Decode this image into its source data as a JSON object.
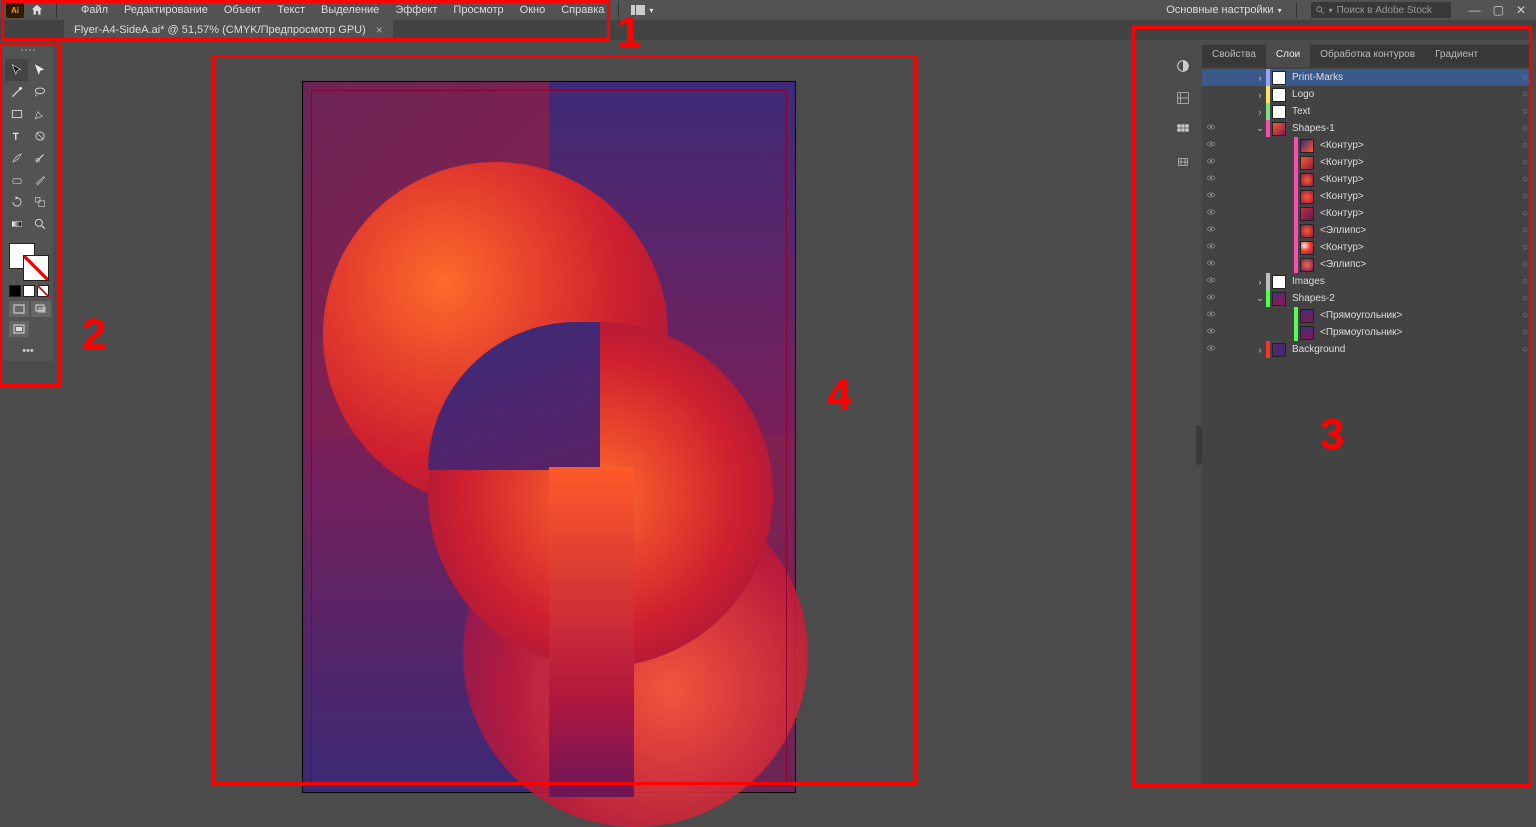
{
  "app": {
    "logo_text": "Ai"
  },
  "menu": {
    "items": [
      "Файл",
      "Редактирование",
      "Объект",
      "Текст",
      "Выделение",
      "Эффект",
      "Просмотр",
      "Окно",
      "Справка"
    ]
  },
  "workspace": {
    "label": "Основные настройки",
    "search_placeholder": "Поиск в Adobe Stock"
  },
  "document": {
    "tab_label": "Flyer-A4-SideA.ai* @ 51,57% (CMYK/Предпросмотр GPU)"
  },
  "panel": {
    "tabs": [
      "Свойства",
      "Слои",
      "Обработка контуров",
      "Градиент"
    ],
    "active_tab": 1,
    "layers": [
      {
        "name": "Print-Marks",
        "depth": 0,
        "color": "#9aa4ff",
        "thumb": "#ffffff",
        "vis": false,
        "exp": ">",
        "selected": true
      },
      {
        "name": "Logo",
        "depth": 0,
        "color": "#ffe06a",
        "thumb": "#ffffff",
        "vis": false,
        "exp": ">"
      },
      {
        "name": "Text",
        "depth": 0,
        "color": "#7fe07f",
        "thumb": "#ffffff",
        "vis": false,
        "exp": ">"
      },
      {
        "name": "Shapes-1",
        "depth": 0,
        "color": "#ff4bb0",
        "thumb": "grad1",
        "vis": true,
        "exp": "v"
      },
      {
        "name": "<Контур>",
        "depth": 1,
        "color": "#ff4bb0",
        "thumb": "grad2",
        "vis": true,
        "exp": ""
      },
      {
        "name": "<Контур>",
        "depth": 1,
        "color": "#ff4bb0",
        "thumb": "grad3",
        "vis": true,
        "exp": ""
      },
      {
        "name": "<Контур>",
        "depth": 1,
        "color": "#ff4bb0",
        "thumb": "grad4",
        "vis": true,
        "exp": ""
      },
      {
        "name": "<Контур>",
        "depth": 1,
        "color": "#ff4bb0",
        "thumb": "grad5",
        "vis": true,
        "exp": ""
      },
      {
        "name": "<Контур>",
        "depth": 1,
        "color": "#ff4bb0",
        "thumb": "grad6",
        "vis": true,
        "exp": ""
      },
      {
        "name": "<Эллипс>",
        "depth": 1,
        "color": "#ff4bb0",
        "thumb": "ell1",
        "vis": true,
        "exp": ""
      },
      {
        "name": "<Контур>",
        "depth": 1,
        "color": "#ff4bb0",
        "thumb": "grad7",
        "vis": true,
        "exp": ""
      },
      {
        "name": "<Эллипс>",
        "depth": 1,
        "color": "#ff4bb0",
        "thumb": "ell2",
        "vis": true,
        "exp": ""
      },
      {
        "name": "Images",
        "depth": 0,
        "color": "#bdbdbd",
        "thumb": "#ffffff",
        "vis": true,
        "exp": ">"
      },
      {
        "name": "Shapes-2",
        "depth": 0,
        "color": "#50ff50",
        "thumb": "sh2",
        "vis": true,
        "exp": "v"
      },
      {
        "name": "<Прямоугольник>",
        "depth": 1,
        "color": "#50ff50",
        "thumb": "rect",
        "vis": true,
        "exp": ""
      },
      {
        "name": "<Прямоугольник>",
        "depth": 1,
        "color": "#50ff50",
        "thumb": "rect",
        "vis": true,
        "exp": ""
      },
      {
        "name": "Background",
        "depth": 0,
        "color": "#ff3030",
        "thumb": "bg",
        "vis": true,
        "exp": ">"
      }
    ]
  },
  "annotations": {
    "n1": "1",
    "n2": "2",
    "n3": "3",
    "n4": "4"
  },
  "tools": {
    "groups": [
      [
        "selection",
        "direct-selection"
      ],
      [
        "pen",
        "curvature"
      ],
      [
        "rectangle",
        "paintbrush"
      ],
      [
        "type",
        "ellipse"
      ],
      [
        "line",
        "shape-builder"
      ],
      [
        "eyedropper",
        "gradient"
      ],
      [
        "scale",
        "free-transform"
      ],
      [
        "mesh",
        "perspective"
      ],
      [
        "artboard",
        "hand"
      ],
      [
        "slice",
        "zoom"
      ]
    ]
  }
}
